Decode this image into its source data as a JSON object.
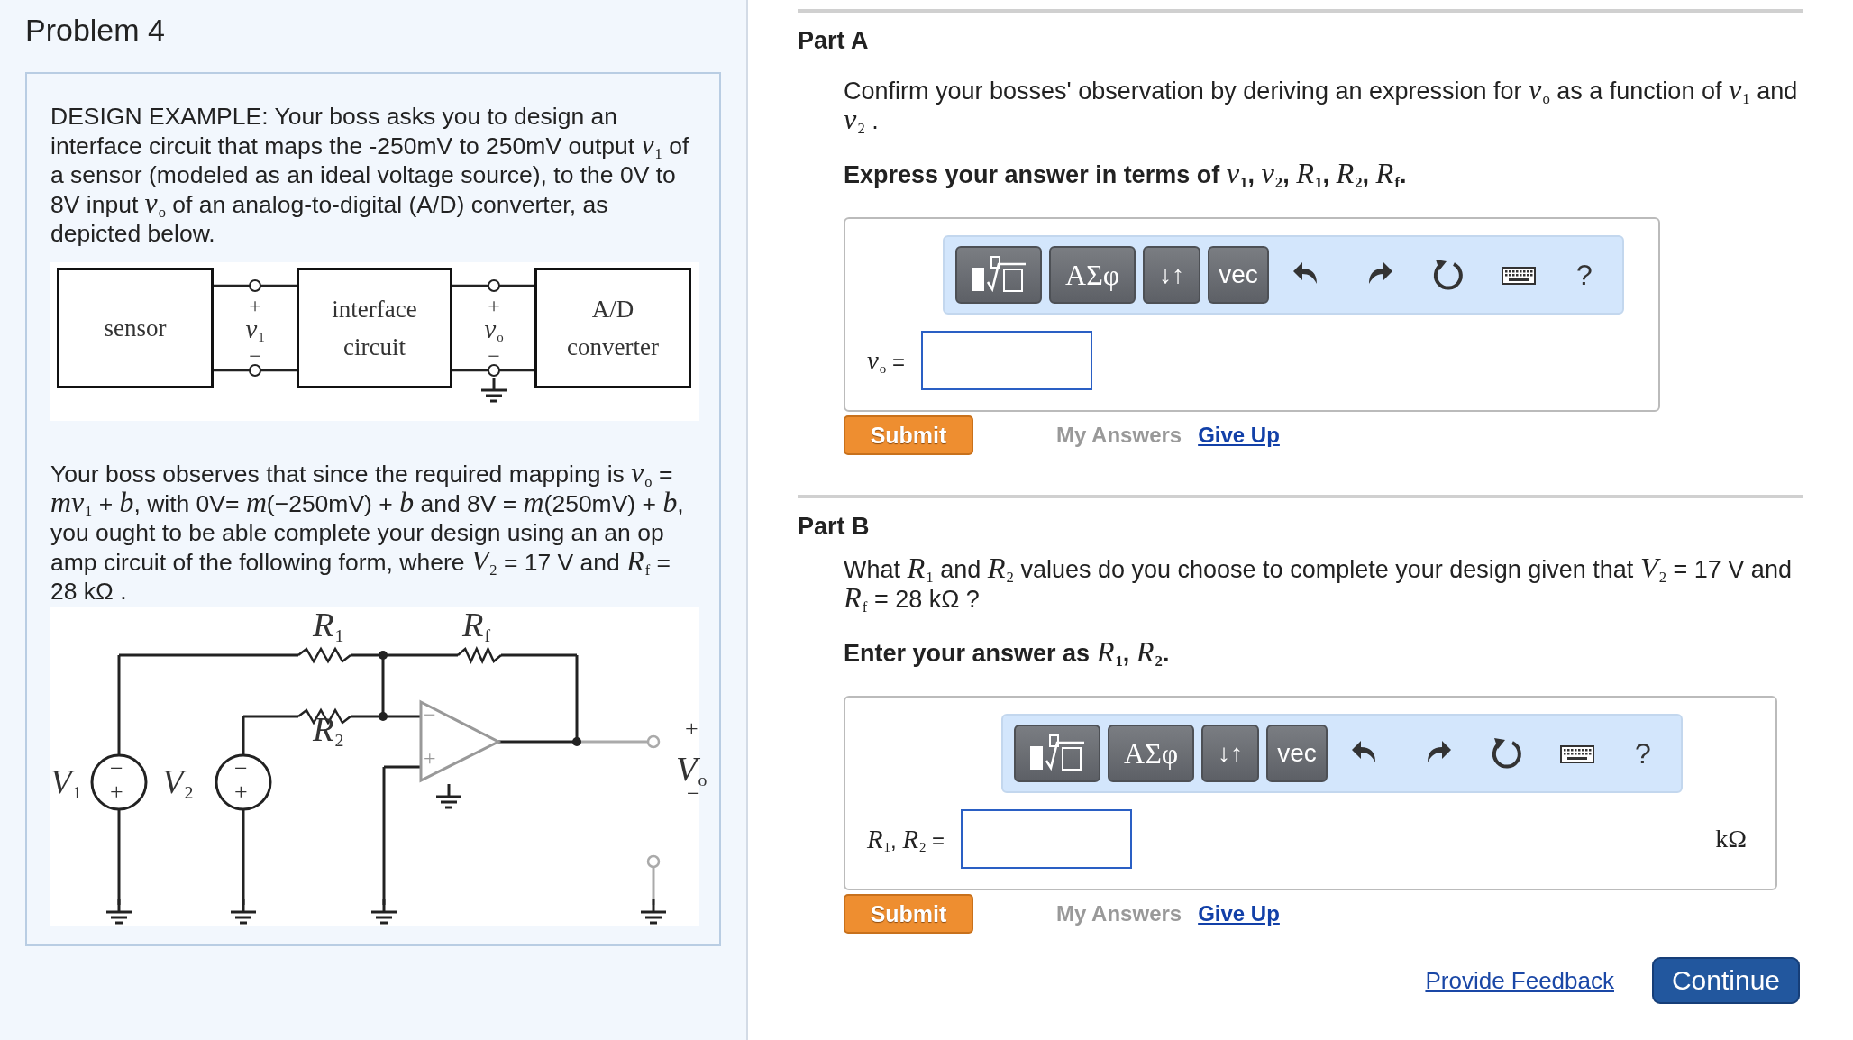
{
  "problem": {
    "title": "Problem 4",
    "intro": "DESIGN EXAMPLE: Your boss asks you to design an interface circuit that maps the -250mV to 250mV output *v*$_{1}$ of a sensor (modeled as an ideal voltage source), to the 0V to 8V input *v*$_{o}$ of an analog-to-digital (A/D) converter, as depicted below.",
    "block_diagram": {
      "blocks": [
        "sensor",
        "interface circuit",
        "A/D converter"
      ],
      "port_labels": [
        "+",
        "*v*$_{1}$",
        "−",
        "+",
        "*v*$_{o}$",
        "−"
      ]
    },
    "observation": "Your boss observes that since the required mapping is *v*$_{o}$ = *mv*$_{1}$ + *b*, with 0V= *m*(−250mV) + *b* and 8V = *m*(250mV) + *b*, you ought to be able complete your design using an an op amp circuit of the following form, where *V*$_{2}$ = 17 V and *R*$_{f}$ = 28 kΩ .",
    "circuit": {
      "labels": [
        "*R*$_{1}$",
        "*R*$_{f}$",
        "*R*$_{2}$",
        "*V*$_{1}$",
        "*V*$_{2}$",
        "+",
        "*V*$_{o}$",
        "−",
        "−",
        "+",
        "−",
        "+",
        "−",
        "+"
      ]
    }
  },
  "parts": [
    {
      "title": "Part A",
      "question": "Confirm your bosses' observation by deriving an expression for *v*$_{o}$ as a function of *v*$_{1}$ and *v*$_{2}$ .",
      "instruction": "Express your answer in terms of *v*$_{1}$, *v*$_{2}$, *R*$_{1}$, *R*$_{2}$, *R*$_{f}$.",
      "toolbar": [
        {
          "kind": "template"
        },
        {
          "kind": "key",
          "label": "ΑΣφ"
        },
        {
          "kind": "key",
          "label": "↓↑"
        },
        {
          "kind": "key",
          "label": "vec"
        },
        {
          "kind": "undo"
        },
        {
          "kind": "redo"
        },
        {
          "kind": "reset"
        },
        {
          "kind": "keyboard"
        },
        {
          "kind": "help",
          "label": "?"
        }
      ],
      "answer_label": "*v*$_{o}$ =",
      "submit": "Submit",
      "my_answers": "My Answers",
      "give_up": "Give Up"
    },
    {
      "title": "Part B",
      "question": "What *R*$_{1}$ and *R*$_{2}$ values do you choose to complete your design given that *V*$_{2}$ = 17 V and *R*$_{f}$ = 28 kΩ ?",
      "instruction": "Enter your answer as *R*$_{1}$, *R*$_{2}$.",
      "toolbar": [
        {
          "kind": "template"
        },
        {
          "kind": "key",
          "label": "ΑΣφ"
        },
        {
          "kind": "key",
          "label": "↓↑"
        },
        {
          "kind": "key",
          "label": "vec"
        },
        {
          "kind": "undo"
        },
        {
          "kind": "redo"
        },
        {
          "kind": "reset"
        },
        {
          "kind": "keyboard"
        },
        {
          "kind": "help",
          "label": "?"
        }
      ],
      "answer_label": "*R*$_{1}$, *R*$_{2}$ =",
      "unit": "kΩ",
      "submit": "Submit",
      "my_answers": "My Answers",
      "give_up": "Give Up"
    }
  ],
  "footer": {
    "feedback": "Provide Feedback",
    "continue": "Continue"
  }
}
